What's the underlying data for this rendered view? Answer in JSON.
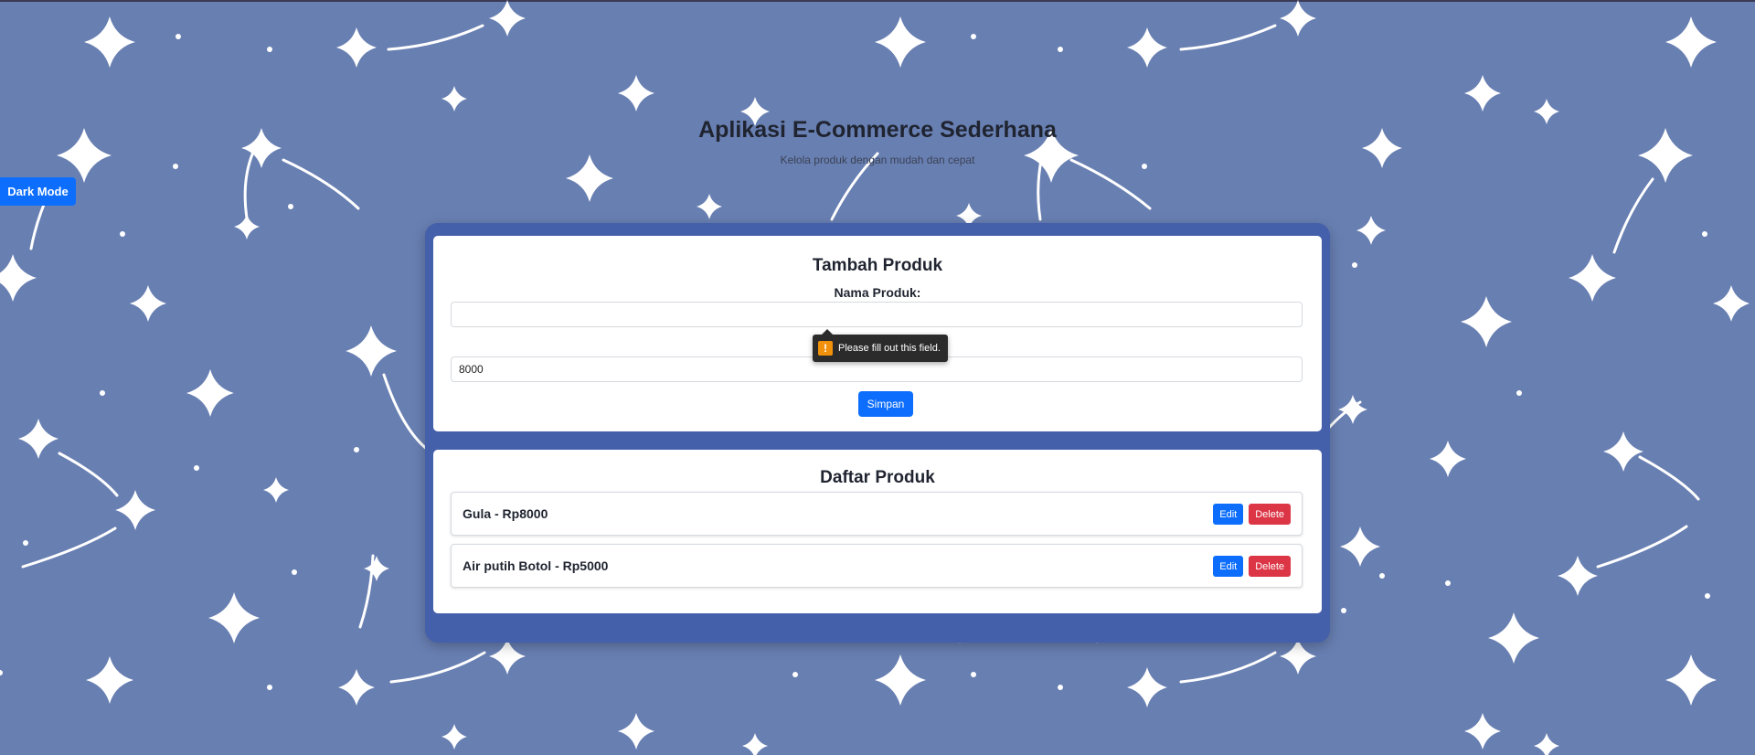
{
  "header": {
    "title": "Aplikasi E-Commerce Sederhana",
    "subtitle": "Kelola produk dengan mudah dan cepat"
  },
  "theme_toggle": {
    "label": "Dark Mode"
  },
  "form": {
    "title": "Tambah Produk",
    "name_label": "Nama Produk:",
    "name_value": "",
    "price_value": "8000",
    "save_label": "Simpan",
    "validation_message": "Please fill out this field."
  },
  "list": {
    "title": "Daftar Produk",
    "items": [
      {
        "text": "Gula - Rp8000",
        "edit_label": "Edit",
        "delete_label": "Delete"
      },
      {
        "text": "Air putih Botol - Rp5000",
        "edit_label": "Edit",
        "delete_label": "Delete"
      }
    ]
  },
  "colors": {
    "background": "#687fb2",
    "card": "#4560ab",
    "primary": "#0d6efd",
    "danger": "#dc3545",
    "warning": "#f0900b"
  },
  "icons": {
    "background_pattern": "four-point-star-pattern",
    "validation": "warning-icon"
  }
}
